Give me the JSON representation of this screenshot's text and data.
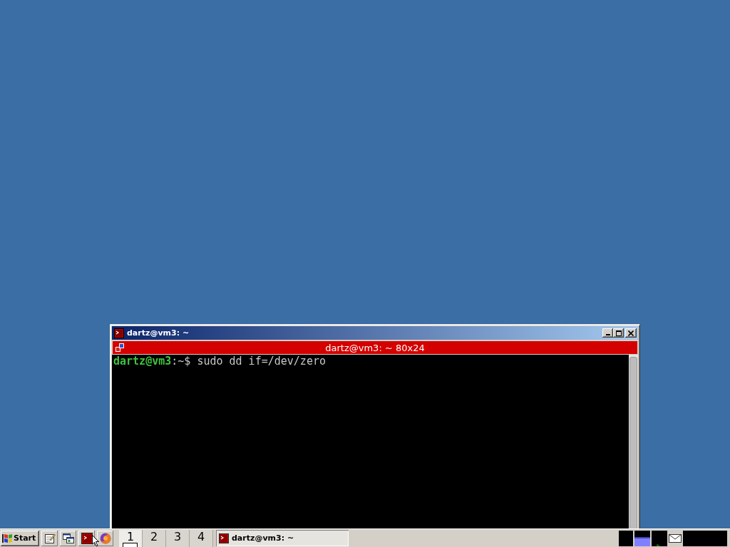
{
  "window": {
    "title": "dartz@vm3: ~"
  },
  "terminal": {
    "title": "dartz@vm3: ~ 80x24",
    "lines": [
      {
        "user": "dartz@vm3",
        "prompt": ":~$",
        "command": "sudo dd if=/dev/zero"
      }
    ]
  },
  "taskbar": {
    "start": "Start",
    "pager": [
      {
        "label": "1",
        "selected": true,
        "has_window": true
      },
      {
        "label": "2",
        "selected": false,
        "has_window": false
      },
      {
        "label": "3",
        "selected": false,
        "has_window": false
      },
      {
        "label": "4",
        "selected": false,
        "has_window": false
      }
    ],
    "tasks": [
      {
        "label": "dartz@vm3: ~"
      }
    ]
  }
}
